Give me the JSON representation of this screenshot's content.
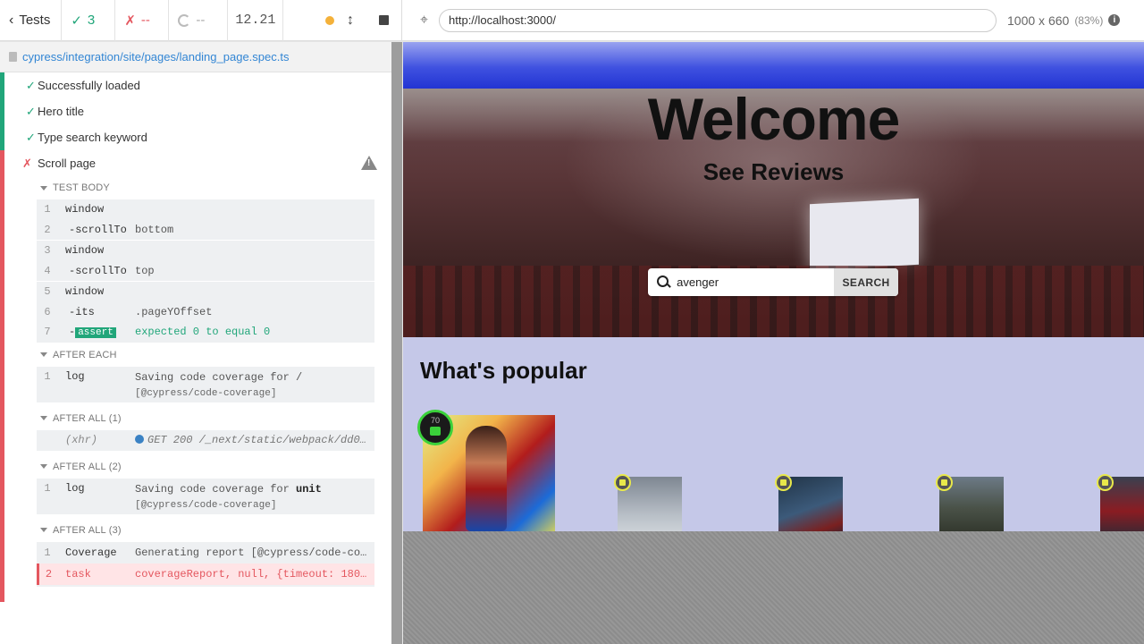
{
  "topbar": {
    "tests_label": "Tests",
    "passed_count": "3",
    "failed_count": "--",
    "pending_count": "--",
    "duration": "12.21"
  },
  "browser": {
    "url": "http://localhost:3000/",
    "viewport": "1000 x 660",
    "scale": "(83%)"
  },
  "reporter": {
    "spec_path": "cypress/integration/site/pages/landing_page.spec.ts",
    "tests": [
      {
        "title": "Successfully loaded",
        "state": "passed"
      },
      {
        "title": "Hero title",
        "state": "passed"
      },
      {
        "title": "Type search keyword",
        "state": "passed"
      },
      {
        "title": "Scroll page",
        "state": "failed"
      }
    ],
    "hooks": {
      "test_body": "TEST BODY",
      "after_each": "AFTER EACH",
      "after_all_1": "AFTER ALL (1)",
      "after_all_2": "AFTER ALL (2)",
      "after_all_3": "AFTER ALL (3)"
    },
    "body_cmds": [
      {
        "num": "1",
        "name": "window",
        "msg": ""
      },
      {
        "num": "2",
        "name": "-scrollTo",
        "msg": "bottom"
      },
      {
        "num": "3",
        "name": "window",
        "msg": ""
      },
      {
        "num": "4",
        "name": "-scrollTo",
        "msg": "top"
      },
      {
        "num": "5",
        "name": "window",
        "msg": ""
      },
      {
        "num": "6",
        "name": "-its",
        "msg": ".pageYOffset"
      },
      {
        "num": "7",
        "name_prefix": "-",
        "name": "assert",
        "msg": "expected 0 to equal 0"
      }
    ],
    "after_each_cmd": {
      "num": "1",
      "name": "log",
      "msg": "Saving code coverage for /",
      "msg2": "[@cypress/code-coverage]"
    },
    "after_all_1_cmd": {
      "name": "(xhr)",
      "msg": "GET 200 /_next/static/webpack/dd0..."
    },
    "after_all_2_cmd": {
      "num": "1",
      "name": "log",
      "msg_pre": "Saving code coverage for ",
      "msg_bold": "unit",
      "msg2": "[@cypress/code-coverage]"
    },
    "after_all_3_cmds": [
      {
        "num": "1",
        "name": "Coverage",
        "msg": "Generating report [@cypress/code-co..."
      },
      {
        "num": "2",
        "name": "task",
        "msg": "coverageReport, null, {timeout: 180..."
      }
    ]
  },
  "app": {
    "hero_title": "Welcome",
    "hero_subtitle": "See Reviews",
    "search_value": "avenger",
    "search_button": "SEARCH",
    "section_title": "What's popular",
    "featured_rating": "70",
    "small_card_colors": [
      "#9aa3ad",
      "#2f4a62",
      "#5a6a5a",
      "#3a3a4a"
    ]
  },
  "colors": {
    "pass": "#21a67a",
    "fail": "#e4575f",
    "link": "#3386d4",
    "appbar": "#2234d3",
    "section_bg": "#c5c8e8"
  }
}
